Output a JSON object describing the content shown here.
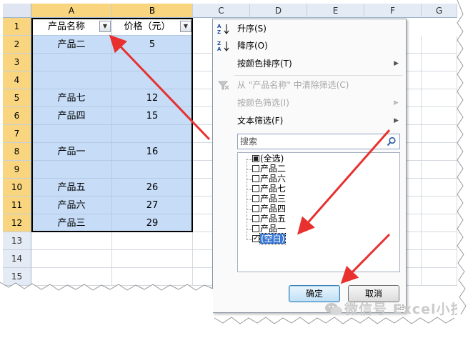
{
  "sheet": {
    "columns": [
      "A",
      "B",
      "C",
      "D",
      "E",
      "F",
      "G"
    ],
    "rows": [
      "1",
      "2",
      "3",
      "4",
      "5",
      "6",
      "7",
      "8",
      "9",
      "10",
      "11",
      "12",
      "13",
      "14",
      "15"
    ],
    "header": {
      "name": "产品名称",
      "price": "价格（元）"
    },
    "data": [
      {
        "name": "产品二",
        "price": "5"
      },
      {
        "name": "",
        "price": ""
      },
      {
        "name": "",
        "price": ""
      },
      {
        "name": "产品七",
        "price": "12"
      },
      {
        "name": "产品四",
        "price": "15"
      },
      {
        "name": "",
        "price": ""
      },
      {
        "name": "产品一",
        "price": "16"
      },
      {
        "name": "",
        "price": ""
      },
      {
        "name": "产品五",
        "price": "26"
      },
      {
        "name": "产品六",
        "price": "27"
      },
      {
        "name": "产品三",
        "price": "29"
      }
    ],
    "filter_button_icon": "filter-dropdown-icon"
  },
  "menu": {
    "sort_asc": "升序(S)",
    "sort_desc": "降序(O)",
    "sort_by_color": "按颜色排序(T)",
    "clear_filter": "从 \"产品名称\" 中清除筛选(C)",
    "filter_by_color": "按颜色筛选(I)",
    "text_filter": "文本筛选(F)",
    "search_placeholder": "搜索",
    "list": [
      {
        "label": "(全选)",
        "state": "partial"
      },
      {
        "label": "产品二",
        "state": "unchecked"
      },
      {
        "label": "产品六",
        "state": "unchecked"
      },
      {
        "label": "产品七",
        "state": "unchecked"
      },
      {
        "label": "产品三",
        "state": "unchecked"
      },
      {
        "label": "产品四",
        "state": "unchecked"
      },
      {
        "label": "产品五",
        "state": "unchecked"
      },
      {
        "label": "产品一",
        "state": "unchecked"
      },
      {
        "label": "(空白)",
        "state": "checked"
      }
    ],
    "ok_label": "确定",
    "cancel_label": "取消"
  },
  "icons": {
    "sort_asc": "sort-ascending-icon",
    "sort_desc": "sort-descending-icon",
    "clear_filter": "clear-filter-icon",
    "search": "search-icon"
  },
  "colors": {
    "selection": "#c6dcf7",
    "header_selected": "#f8d57e",
    "annotation_arrow": "#e8302f"
  },
  "watermark": "微信号 Excel小技巧"
}
